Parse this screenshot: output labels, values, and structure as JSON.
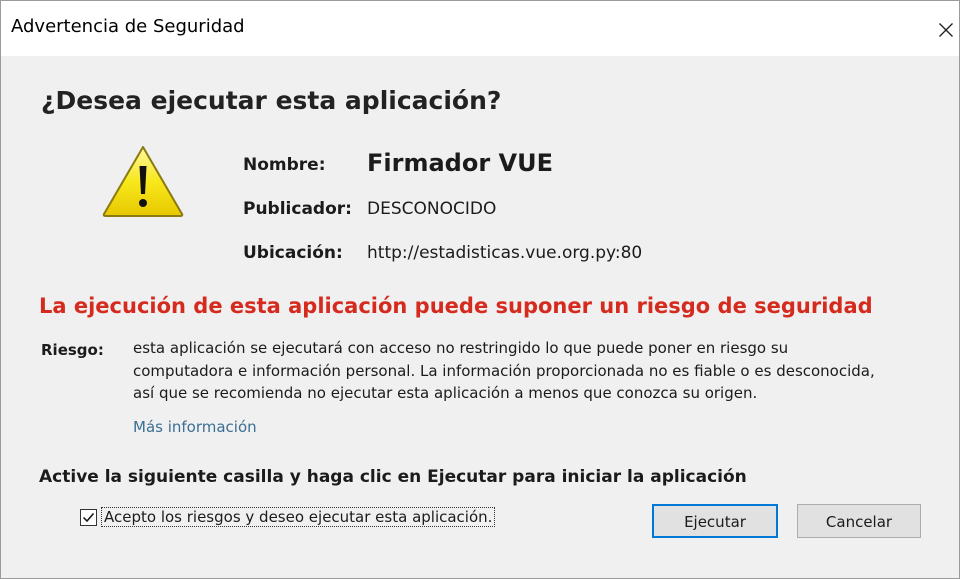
{
  "window": {
    "title": "Advertencia de Seguridad",
    "close_icon": "close-icon"
  },
  "dialog": {
    "headline": "¿Desea ejecutar esta aplicación?",
    "icon": "warning-icon",
    "colors": {
      "warning_yellow": "#f5e000",
      "risk_red": "#d52a1e",
      "link_blue": "#3a6f93",
      "primary_border": "#0078d7"
    },
    "info": {
      "name_label": "Nombre:",
      "name_value": "Firmador VUE",
      "publisher_label": "Publicador:",
      "publisher_value": "DESCONOCIDO",
      "location_label": "Ubicación:",
      "location_value": "http://estadisticas.vue.org.py:80"
    },
    "risk_heading": "La ejecución de esta aplicación puede suponer un riesgo de seguridad",
    "risk_label": "Riesgo:",
    "risk_lines": [
      "esta aplicación se ejecutará con acceso no restringido lo que puede poner en riesgo su",
      "computadora e información personal. La información proporcionada no es fiable o es desconocida,",
      "así que se recomienda no ejecutar esta aplicación a menos que conozca su origen."
    ],
    "more_info_link": "Más información",
    "instruction": "Active la siguiente casilla y haga clic en Ejecutar para iniciar la aplicación",
    "checkbox": {
      "label": "Acepto los riesgos y deseo ejecutar esta aplicación.",
      "checked": true
    },
    "buttons": {
      "run": "Ejecutar",
      "cancel": "Cancelar"
    }
  }
}
